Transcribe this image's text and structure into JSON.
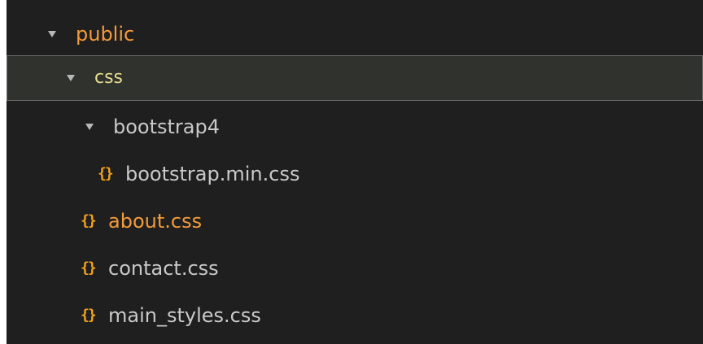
{
  "colors": {
    "background": "#1f1f1f",
    "selected_background": "#2f322d",
    "selected_border": "#6b6b6b",
    "default_text": "#c9c9c9",
    "modified_text": "#f39b3a",
    "selected_text": "#e8df8d",
    "icon": "#f4a21b"
  },
  "tree": {
    "public": {
      "label": "public",
      "expanded": true
    },
    "css": {
      "label": "css",
      "expanded": true,
      "selected": true
    },
    "bootstrap4": {
      "label": "bootstrap4",
      "expanded": true
    },
    "files": [
      {
        "label": "bootstrap.min.css",
        "icon": "css-braces-icon",
        "modified": false
      },
      {
        "label": "about.css",
        "icon": "css-braces-icon",
        "modified": true
      },
      {
        "label": "contact.css",
        "icon": "css-braces-icon",
        "modified": false
      },
      {
        "label": "main_styles.css",
        "icon": "css-braces-icon",
        "modified": false
      }
    ]
  }
}
